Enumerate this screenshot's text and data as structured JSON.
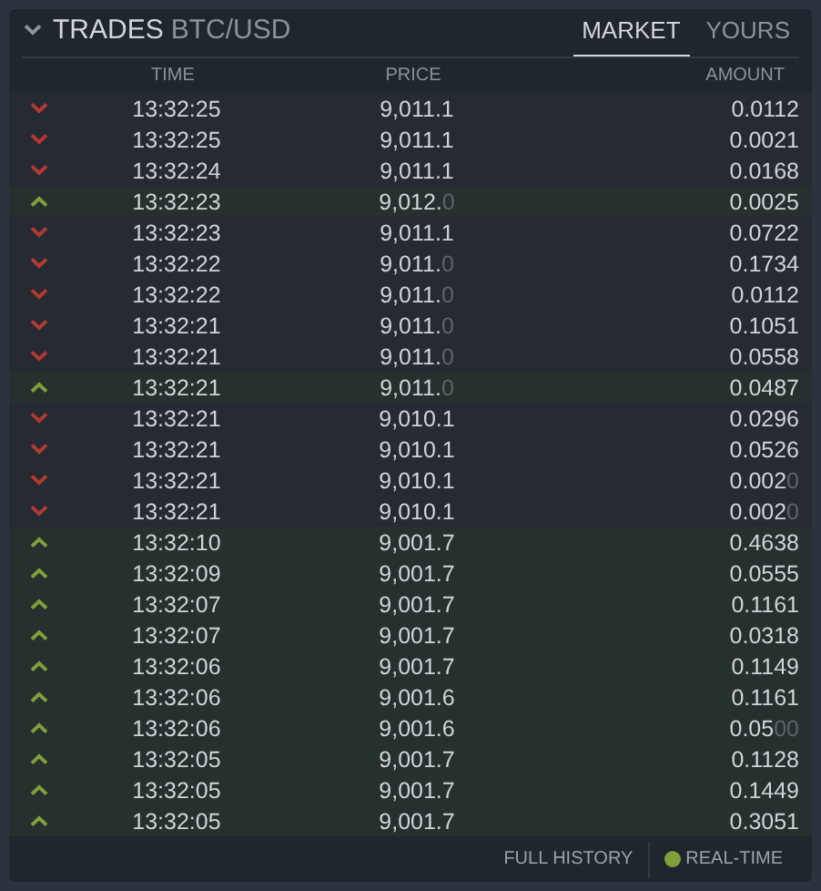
{
  "panel": {
    "expanded": true,
    "title": "TRADES",
    "pair": "BTC/USD"
  },
  "tabs": [
    {
      "label": "MARKET",
      "selected": true
    },
    {
      "label": "YOURS",
      "selected": false
    }
  ],
  "columns": [
    "TIME",
    "PRICE",
    "AMOUNT"
  ],
  "trades": [
    {
      "kind": "sell",
      "time": "13:32:25",
      "price": "9,011.1",
      "amount": "0.0112"
    },
    {
      "kind": "sell",
      "time": "13:32:25",
      "price": "9,011.1",
      "amount": "0.0021"
    },
    {
      "kind": "sell",
      "time": "13:32:24",
      "price": "9,011.1",
      "amount": "0.0168"
    },
    {
      "kind": "buy",
      "time": "13:32:23",
      "price": "9,012.",
      "price_faded": "0",
      "amount": "0.0025"
    },
    {
      "kind": "sell",
      "time": "13:32:23",
      "price": "9,011.1",
      "amount": "0.0722"
    },
    {
      "kind": "sell",
      "time": "13:32:22",
      "price": "9,011.",
      "price_faded": "0",
      "amount": "0.1734"
    },
    {
      "kind": "sell",
      "time": "13:32:22",
      "price": "9,011.",
      "price_faded": "0",
      "amount": "0.0112"
    },
    {
      "kind": "sell",
      "time": "13:32:21",
      "price": "9,011.",
      "price_faded": "0",
      "amount": "0.1051"
    },
    {
      "kind": "sell",
      "time": "13:32:21",
      "price": "9,011.",
      "price_faded": "0",
      "amount": "0.0558"
    },
    {
      "kind": "buy",
      "time": "13:32:21",
      "price": "9,011.",
      "price_faded": "0",
      "amount": "0.0487"
    },
    {
      "kind": "sell",
      "time": "13:32:21",
      "price": "9,010.1",
      "amount": "0.0296"
    },
    {
      "kind": "sell",
      "time": "13:32:21",
      "price": "9,010.1",
      "amount": "0.0526"
    },
    {
      "kind": "sell",
      "time": "13:32:21",
      "price": "9,010.1",
      "amount": "0.002",
      "amount_faded": "0"
    },
    {
      "kind": "sell",
      "time": "13:32:21",
      "price": "9,010.1",
      "amount": "0.002",
      "amount_faded": "0"
    },
    {
      "kind": "buy",
      "time": "13:32:10",
      "price": "9,001.7",
      "amount": "0.4638"
    },
    {
      "kind": "buy",
      "time": "13:32:09",
      "price": "9,001.7",
      "amount": "0.0555"
    },
    {
      "kind": "buy",
      "time": "13:32:07",
      "price": "9,001.7",
      "amount": "0.1161"
    },
    {
      "kind": "buy",
      "time": "13:32:07",
      "price": "9,001.7",
      "amount": "0.0318"
    },
    {
      "kind": "buy",
      "time": "13:32:06",
      "price": "9,001.7",
      "amount": "0.1149"
    },
    {
      "kind": "buy",
      "time": "13:32:06",
      "price": "9,001.6",
      "amount": "0.1161"
    },
    {
      "kind": "buy",
      "time": "13:32:06",
      "price": "9,001.6",
      "amount": "0.05",
      "amount_faded": "00"
    },
    {
      "kind": "buy",
      "time": "13:32:05",
      "price": "9,001.7",
      "amount": "0.1128"
    },
    {
      "kind": "buy",
      "time": "13:32:05",
      "price": "9,001.7",
      "amount": "0.1449"
    },
    {
      "kind": "buy",
      "time": "13:32:05",
      "price": "9,001.7",
      "amount": "0.3051"
    }
  ],
  "footer": {
    "history_link": "FULL HISTORY",
    "realtime": {
      "label": "REAL-TIME",
      "on": true
    }
  }
}
